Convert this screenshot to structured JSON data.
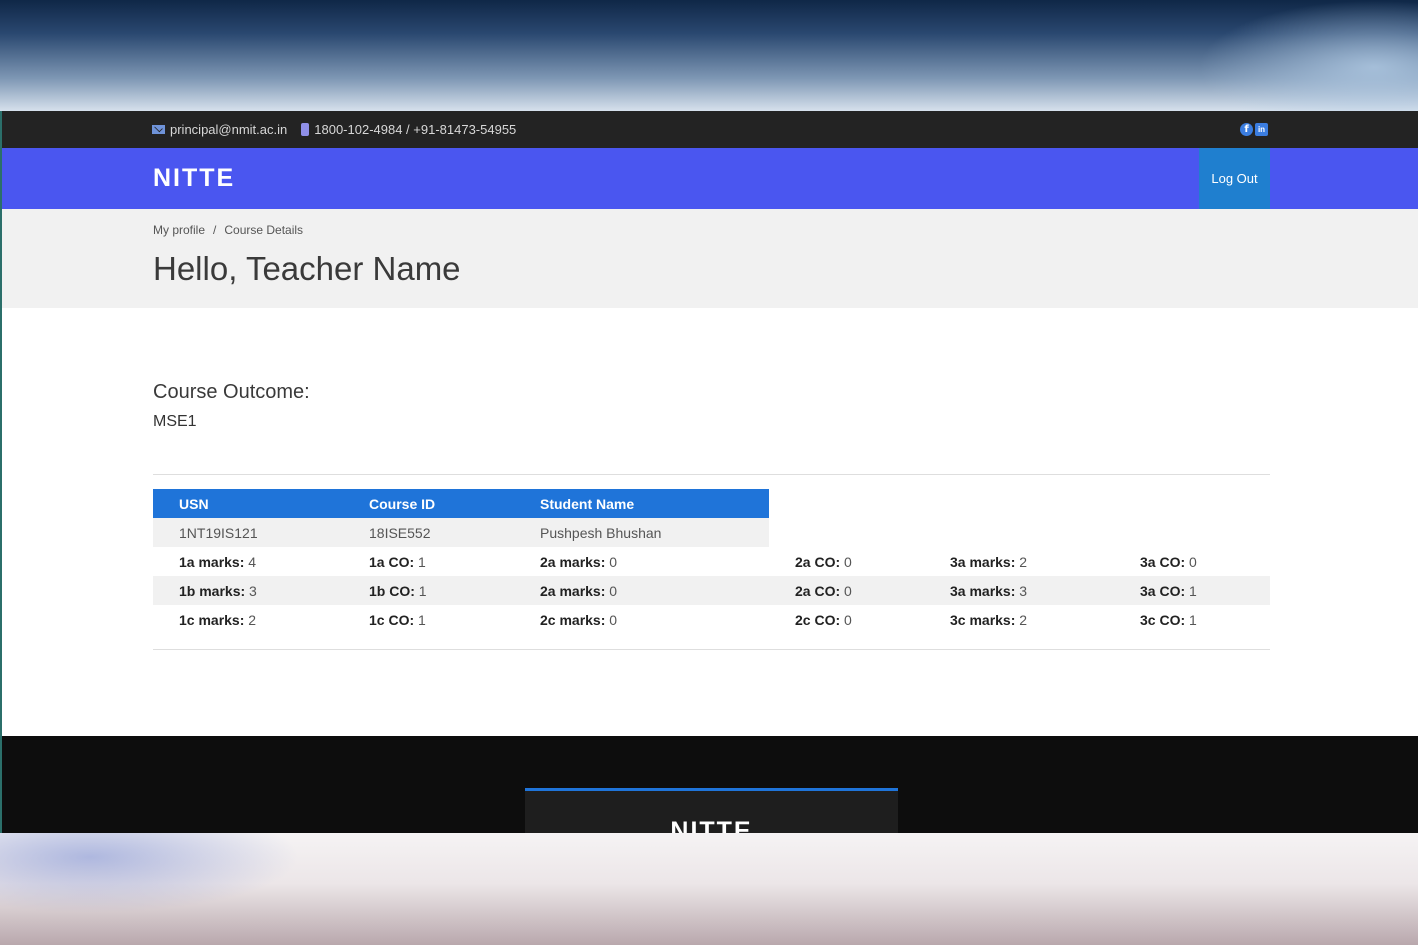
{
  "topbar": {
    "email": "principal@nmit.ac.in",
    "phone": "1800-102-4984 / +91-81473-54955",
    "icons": [
      "mail-icon",
      "phone-icon",
      "facebook-icon",
      "linkedin-icon"
    ]
  },
  "navbar": {
    "brand": "NITTE",
    "logout_label": "Log Out"
  },
  "breadcrumb": {
    "home": "My profile",
    "separator": "/",
    "current": "Course Details"
  },
  "page": {
    "title": "Hello, Teacher Name"
  },
  "course": {
    "heading": "Course Outcome:",
    "exam": "MSE1"
  },
  "table": {
    "headers": [
      "USN",
      "Course ID",
      "Student Name"
    ],
    "student": {
      "usn": "1NT19IS121",
      "course_id": "18ISE552",
      "name": "Pushpesh Bhushan"
    },
    "rows": [
      [
        {
          "label": "1a marks:",
          "value": "4"
        },
        {
          "label": "1a CO:",
          "value": "1"
        },
        {
          "label": "2a marks:",
          "value": "0"
        },
        {
          "label": "2a CO:",
          "value": "0"
        },
        {
          "label": "3a marks:",
          "value": "2"
        },
        {
          "label": "3a CO:",
          "value": "0"
        }
      ],
      [
        {
          "label": "1b marks:",
          "value": "3"
        },
        {
          "label": "1b CO:",
          "value": "1"
        },
        {
          "label": "2a marks:",
          "value": "0"
        },
        {
          "label": "2a CO:",
          "value": "0"
        },
        {
          "label": "3a marks:",
          "value": "3"
        },
        {
          "label": "3a CO:",
          "value": "1"
        }
      ],
      [
        {
          "label": "1c marks:",
          "value": "2"
        },
        {
          "label": "1c CO:",
          "value": "1"
        },
        {
          "label": "2c marks:",
          "value": "0"
        },
        {
          "label": "2c CO:",
          "value": "0"
        },
        {
          "label": "3c marks:",
          "value": "2"
        },
        {
          "label": "3c CO:",
          "value": "1"
        }
      ]
    ]
  },
  "footer": {
    "brand": "NITTE"
  },
  "colors": {
    "navbar": "#4a56f0",
    "accent": "#1f74d9",
    "topbar": "#232323",
    "footer": "#0d0d0d"
  }
}
